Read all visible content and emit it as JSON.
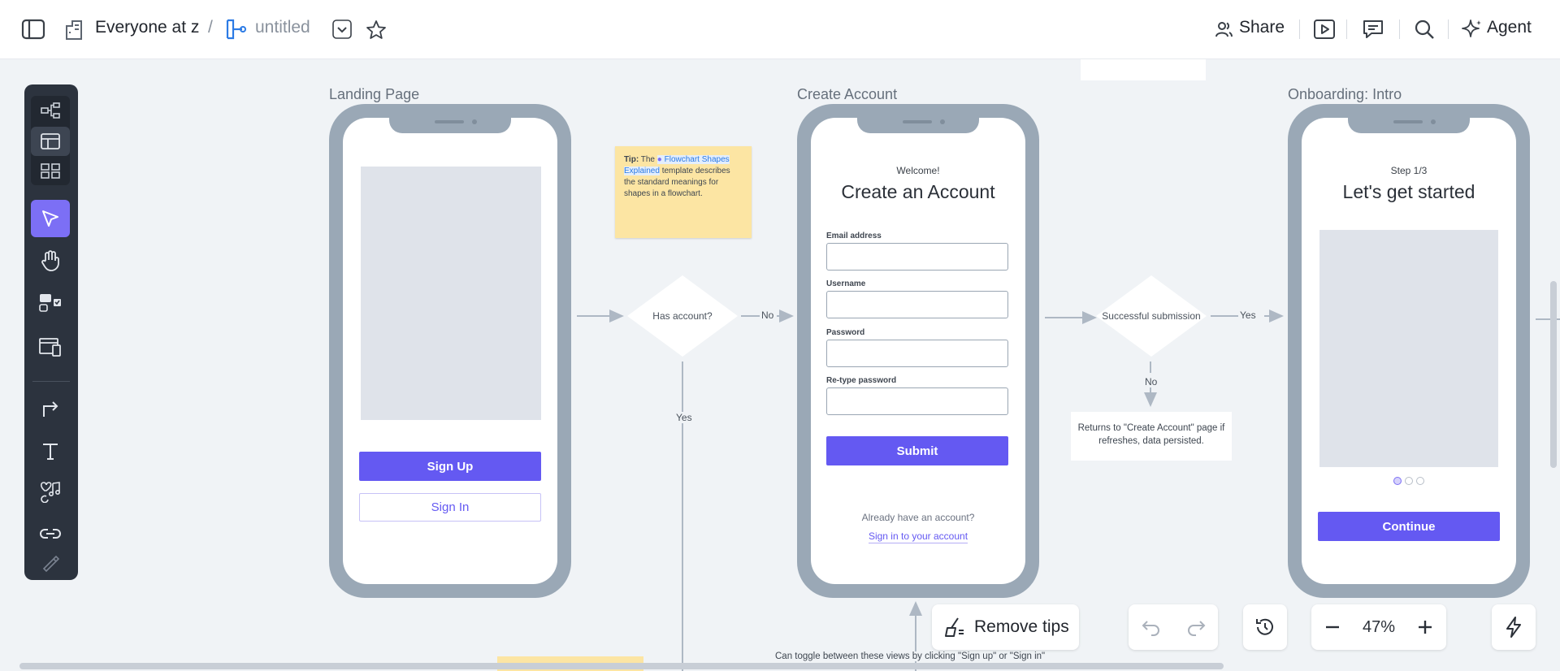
{
  "topbar": {
    "workspace": "Everyone at z",
    "separator": "/",
    "doc_title": "untitled",
    "share_label": "Share",
    "agent_label": "Agent"
  },
  "frames": {
    "landing_title": "Landing Page",
    "create_title": "Create Account",
    "onboarding_title": "Onboarding: Intro"
  },
  "landing": {
    "signup_label": "Sign Up",
    "signin_label": "Sign In"
  },
  "create": {
    "welcome": "Welcome!",
    "heading": "Create an Account",
    "email_label": "Email address",
    "username_label": "Username",
    "password_label": "Password",
    "retype_label": "Re-type password",
    "submit_label": "Submit",
    "already_text": "Already have an account?",
    "signin_link": "Sign in to your account"
  },
  "onboarding": {
    "step": "Step 1/3",
    "heading": "Let's get started",
    "continue_label": "Continue"
  },
  "flow": {
    "decision1": "Has account?",
    "no1": "No",
    "yes1": "Yes",
    "decision2": "Successful submission",
    "yes2": "Yes",
    "no2": "No",
    "returns_note": "Returns to \"Create Account\" page if refreshes, data persisted."
  },
  "sticky": {
    "tip_bold": "Tip:",
    "tip_pre": "The",
    "tip_link": "Flowchart Shapes Explained",
    "tip_post": "template describes the standard meanings for shapes in a flowchart."
  },
  "bottom": {
    "remove_tips": "Remove tips",
    "zoom": "47%",
    "toggle_caption": "Can toggle between these views by clicking \"Sign up\" or \"Sign in\""
  },
  "colors": {
    "accent": "#6459f2",
    "toolbar_bg": "#2c333e",
    "active_tool": "#7c6ff5",
    "canvas_bg": "#f0f3f6",
    "phone_frame": "#9aa8b6",
    "sticky": "#fce5a3",
    "link_blue": "#2c7be5"
  }
}
